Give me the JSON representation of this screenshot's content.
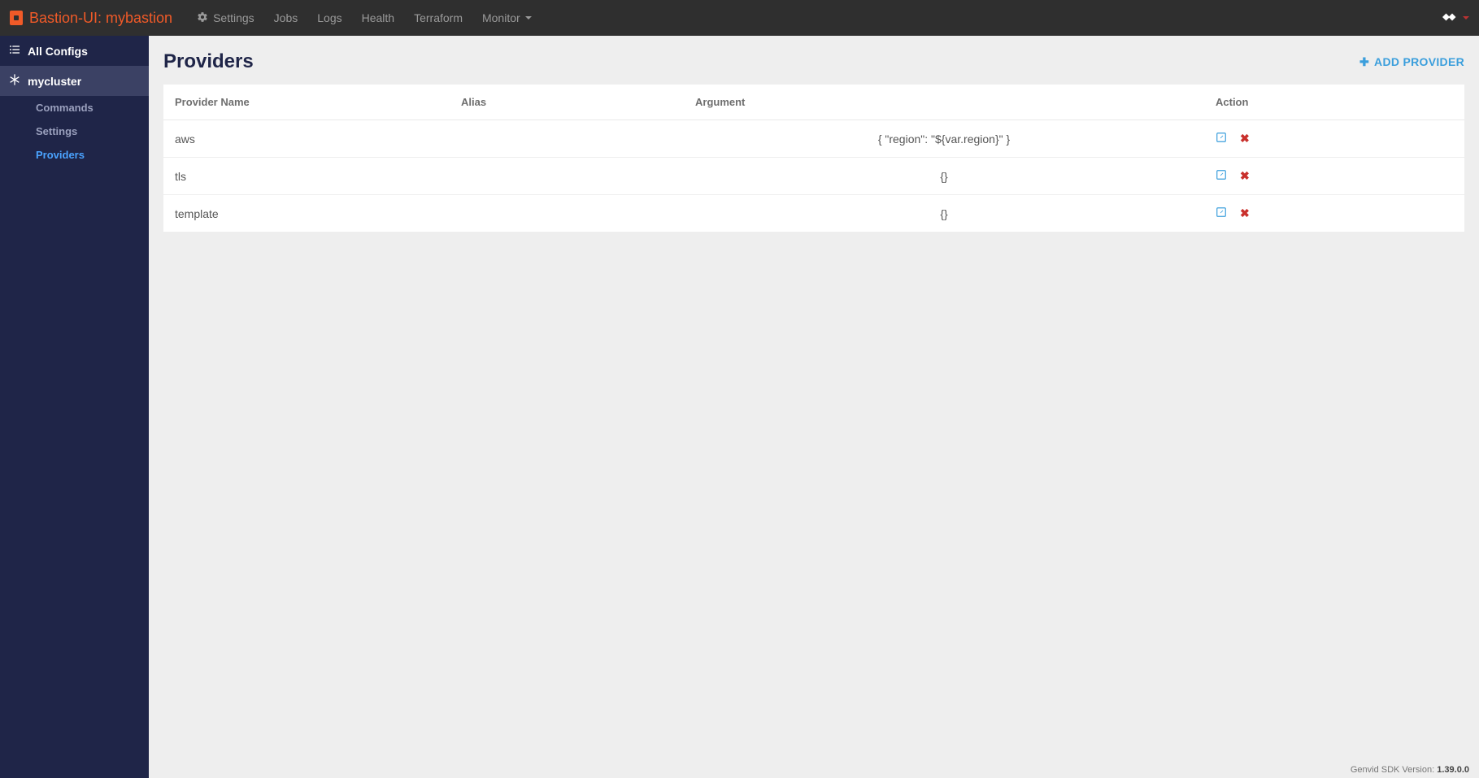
{
  "topnav": {
    "brand": "Bastion-UI: mybastion",
    "links": {
      "settings": "Settings",
      "jobs": "Jobs",
      "logs": "Logs",
      "health": "Health",
      "terraform": "Terraform",
      "monitor": "Monitor"
    }
  },
  "sidebar": {
    "all_configs": "All Configs",
    "cluster": "mycluster",
    "sub": {
      "commands": "Commands",
      "settings": "Settings",
      "providers": "Providers"
    }
  },
  "page": {
    "title": "Providers",
    "add_provider": "ADD PROVIDER"
  },
  "table": {
    "headers": {
      "name": "Provider Name",
      "alias": "Alias",
      "argument": "Argument",
      "action": "Action"
    },
    "rows": [
      {
        "name": "aws",
        "alias": "",
        "argument": "{ \"region\": \"${var.region}\" }"
      },
      {
        "name": "tls",
        "alias": "",
        "argument": "{}"
      },
      {
        "name": "template",
        "alias": "",
        "argument": "{}"
      }
    ]
  },
  "footer": {
    "label": "Genvid SDK Version:",
    "version": "1.39.0.0"
  }
}
